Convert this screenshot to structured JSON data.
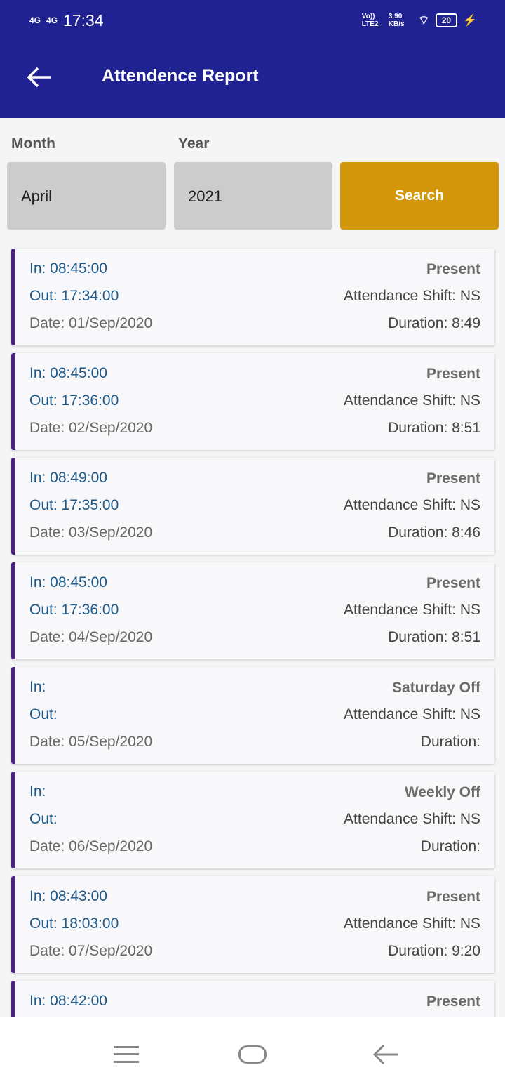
{
  "status_bar": {
    "net1": "4G",
    "net2": "4G",
    "time": "17:34",
    "volte": "Vo)) LTE2",
    "speed": "3.90 KB/s",
    "battery": "20"
  },
  "header": {
    "title": "Attendence Report"
  },
  "filters": {
    "month_label": "Month",
    "month_value": "April",
    "year_label": "Year",
    "year_value": "2021",
    "search_label": "Search"
  },
  "records": [
    {
      "in": "In: 08:45:00",
      "out": "Out: 17:34:00",
      "date": "Date: 01/Sep/2020",
      "status": "Present",
      "shift": "Attendance Shift: NS",
      "duration": "Duration: 8:49"
    },
    {
      "in": "In: 08:45:00",
      "out": "Out: 17:36:00",
      "date": "Date: 02/Sep/2020",
      "status": "Present",
      "shift": "Attendance Shift: NS",
      "duration": "Duration: 8:51"
    },
    {
      "in": "In: 08:49:00",
      "out": "Out: 17:35:00",
      "date": "Date: 03/Sep/2020",
      "status": "Present",
      "shift": "Attendance Shift: NS",
      "duration": "Duration: 8:46"
    },
    {
      "in": "In: 08:45:00",
      "out": "Out: 17:36:00",
      "date": "Date: 04/Sep/2020",
      "status": "Present",
      "shift": "Attendance Shift: NS",
      "duration": "Duration: 8:51"
    },
    {
      "in": "In:",
      "out": "Out:",
      "date": "Date: 05/Sep/2020",
      "status": "Saturday Off",
      "shift": "Attendance Shift: NS",
      "duration": "Duration:"
    },
    {
      "in": "In:",
      "out": "Out:",
      "date": "Date: 06/Sep/2020",
      "status": "Weekly Off",
      "shift": "Attendance Shift: NS",
      "duration": "Duration:"
    },
    {
      "in": "In: 08:43:00",
      "out": "Out: 18:03:00",
      "date": "Date: 07/Sep/2020",
      "status": "Present",
      "shift": "Attendance Shift: NS",
      "duration": "Duration: 9:20"
    },
    {
      "in": "In: 08:42:00",
      "out": "",
      "date": "",
      "status": "Present",
      "shift": "",
      "duration": ""
    }
  ],
  "colors": {
    "header": "#1f2290",
    "search": "#d4960a",
    "accent": "#4a2580"
  }
}
